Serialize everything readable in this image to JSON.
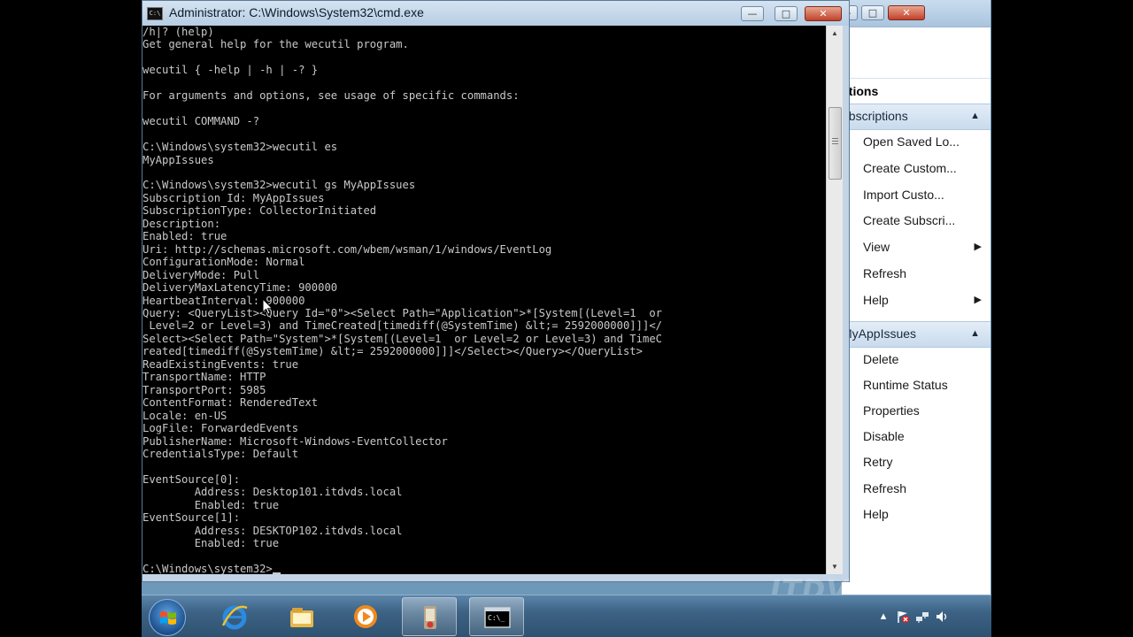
{
  "cmd": {
    "title": "Administrator: C:\\Windows\\System32\\cmd.exe",
    "icon_label": "C:\\",
    "output": [
      "/h|? (help)",
      "Get general help for the wecutil program.",
      "",
      "wecutil { -help | -h | -? }",
      "",
      "For arguments and options, see usage of specific commands:",
      "",
      "wecutil COMMAND -?",
      "",
      "C:\\Windows\\system32>wecutil es",
      "MyAppIssues",
      "",
      "C:\\Windows\\system32>wecutil gs MyAppIssues",
      "Subscription Id: MyAppIssues",
      "SubscriptionType: CollectorInitiated",
      "Description:",
      "Enabled: true",
      "Uri: http://schemas.microsoft.com/wbem/wsman/1/windows/EventLog",
      "ConfigurationMode: Normal",
      "DeliveryMode: Pull",
      "DeliveryMaxLatencyTime: 900000",
      "HeartbeatInterval: 900000",
      "Query: <QueryList><Query Id=\"0\"><Select Path=\"Application\">*[System[(Level=1  or",
      " Level=2 or Level=3) and TimeCreated[timediff(@SystemTime) &lt;= 2592000000]]]</",
      "Select><Select Path=\"System\">*[System[(Level=1  or Level=2 or Level=3) and TimeC",
      "reated[timediff(@SystemTime) &lt;= 2592000000]]]</Select></Query></QueryList>",
      "ReadExistingEvents: true",
      "TransportName: HTTP",
      "TransportPort: 5985",
      "ContentFormat: RenderedText",
      "Locale: en-US",
      "LogFile: ForwardedEvents",
      "PublisherName: Microsoft-Windows-EventCollector",
      "CredentialsType: Default",
      "",
      "EventSource[0]:",
      "        Address: Desktop101.itdvds.local",
      "        Enabled: true",
      "EventSource[1]:",
      "        Address: DESKTOP102.itdvds.local",
      "        Enabled: true",
      ""
    ],
    "prompt": "C:\\Windows\\system32>"
  },
  "window_buttons": {
    "minimize": "—",
    "maximize": "□",
    "close": "✕"
  },
  "event_viewer": {
    "actions_header": "ctions",
    "sections": [
      {
        "label": "ubscriptions",
        "items": [
          {
            "label": "Open Saved Lo...",
            "icon": "folder-icon",
            "submenu": false
          },
          {
            "label": "Create Custom...",
            "icon": "filter-icon",
            "submenu": false
          },
          {
            "label": "Import Custo...",
            "icon": "",
            "submenu": false
          },
          {
            "label": "Create Subscri...",
            "icon": "",
            "submenu": false
          },
          {
            "label": "View",
            "icon": "",
            "submenu": true
          },
          {
            "label": "Refresh",
            "icon": "refresh-icon",
            "submenu": false
          },
          {
            "label": "Help",
            "icon": "help-icon",
            "submenu": true
          }
        ]
      },
      {
        "label": "MyAppIssues",
        "items": [
          {
            "label": "Delete",
            "icon": "",
            "submenu": false
          },
          {
            "label": "Runtime Status",
            "icon": "",
            "submenu": false
          },
          {
            "label": "Properties",
            "icon": "",
            "submenu": false
          },
          {
            "label": "Disable",
            "icon": "",
            "submenu": false
          },
          {
            "label": "Retry",
            "icon": "",
            "submenu": false
          },
          {
            "label": "Refresh",
            "icon": "refresh-icon",
            "submenu": false
          },
          {
            "label": "Help",
            "icon": "help-icon",
            "submenu": false
          }
        ]
      }
    ]
  },
  "taskbar": {
    "icons": [
      "start-orb-icon",
      "internet-explorer-icon",
      "windows-explorer-icon",
      "media-player-icon",
      "event-viewer-icon",
      "command-prompt-icon"
    ],
    "active": "command-prompt-icon",
    "tray": [
      "chevron-up-icon",
      "action-center-flag-icon",
      "network-icon",
      "volume-icon"
    ]
  },
  "watermark": "ITDVDS.COM"
}
